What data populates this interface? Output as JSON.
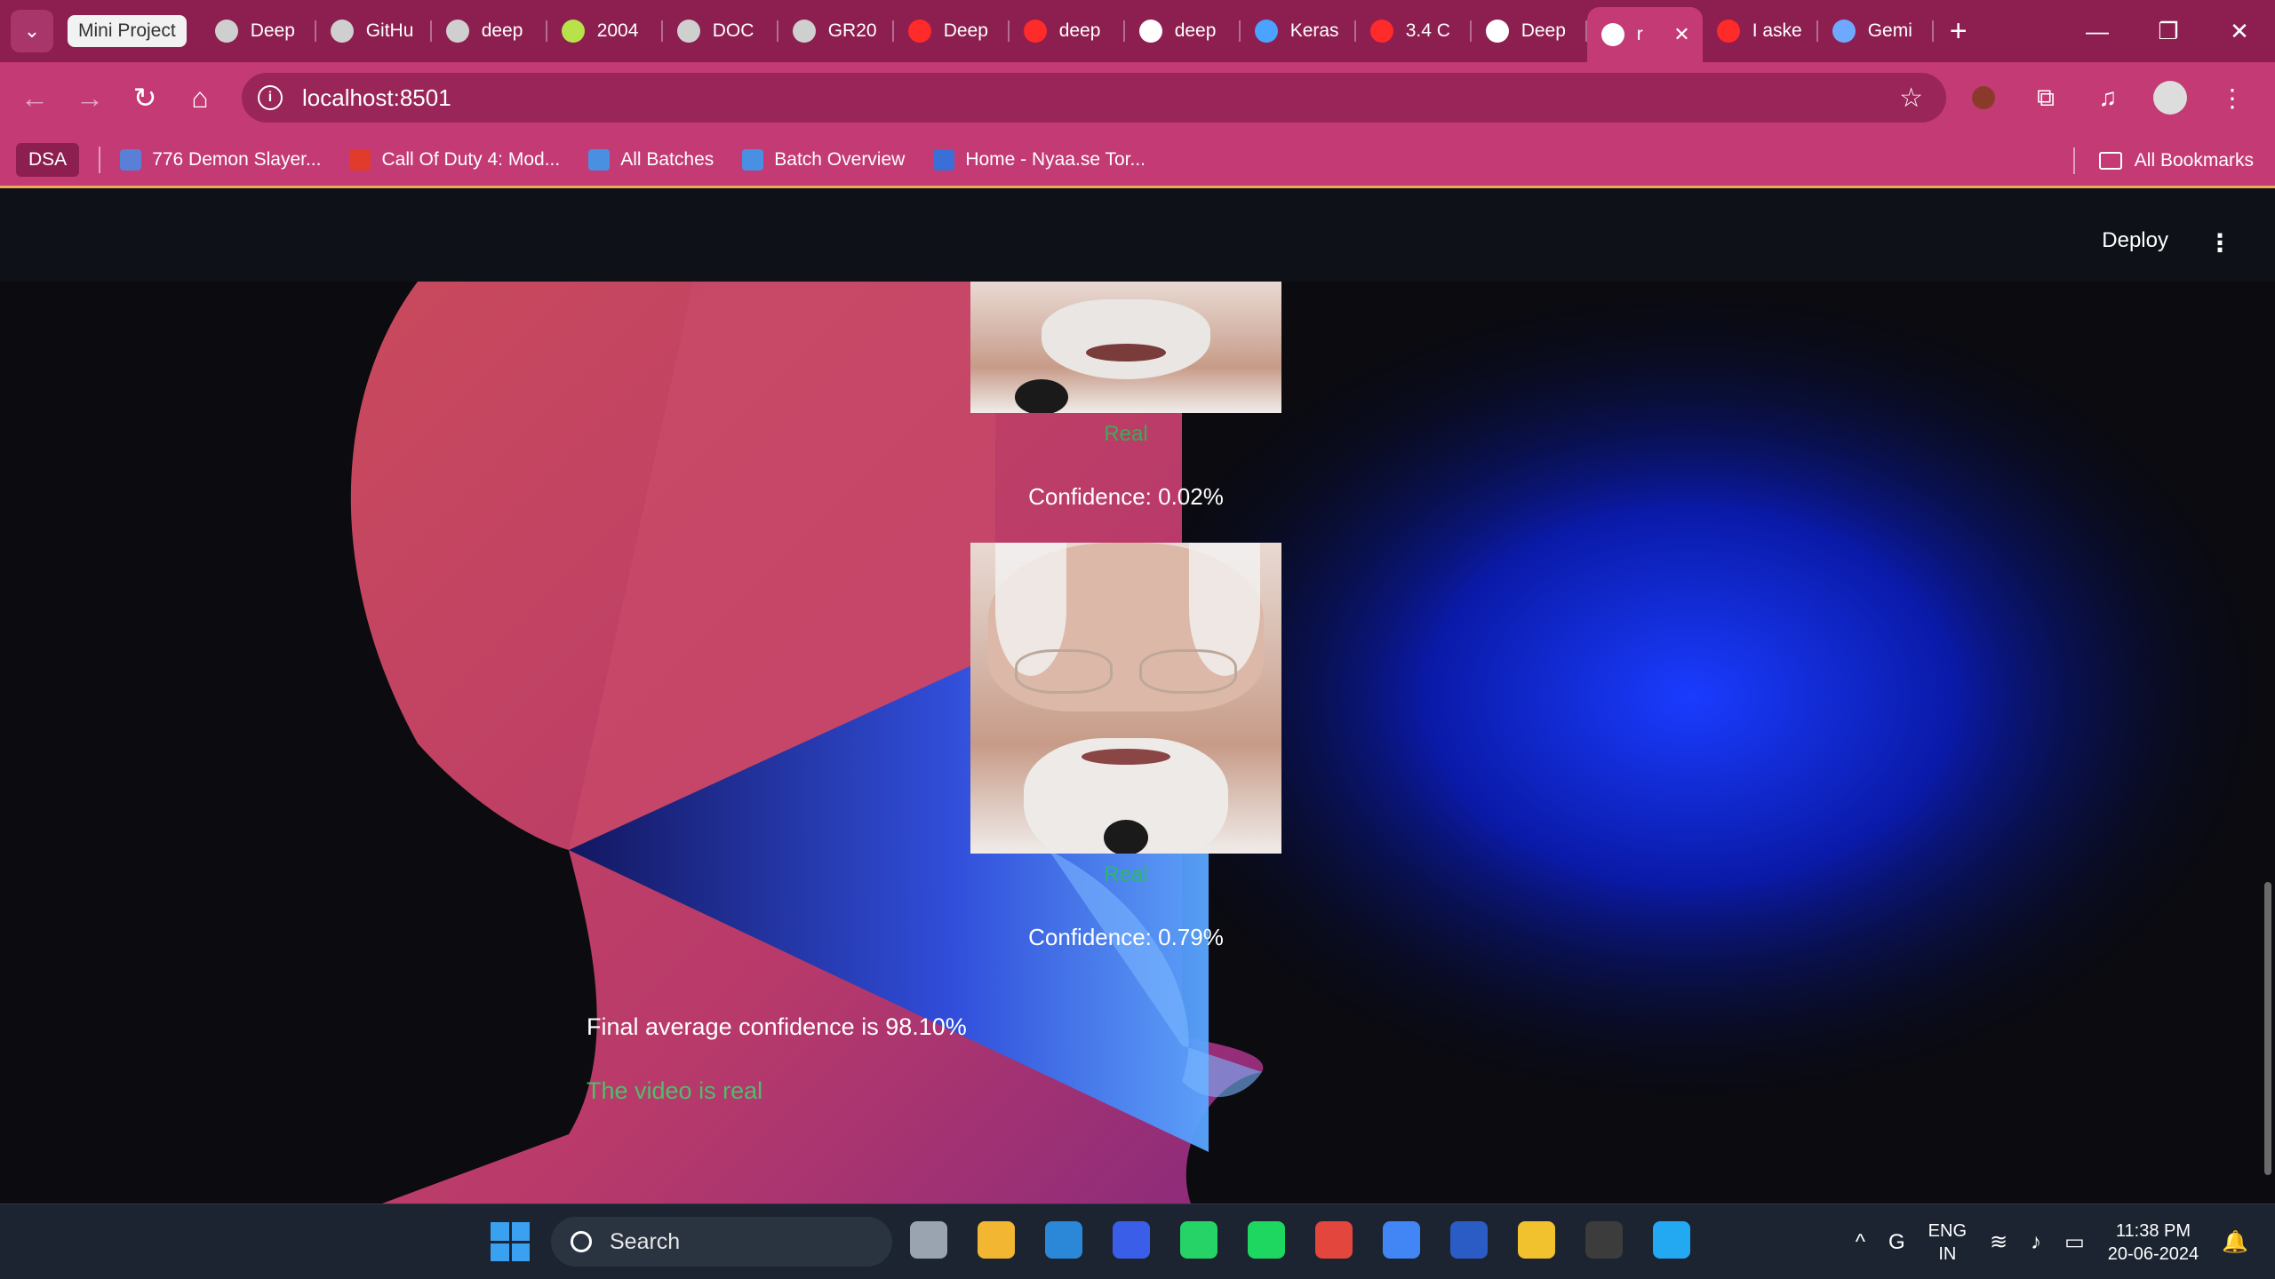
{
  "browser": {
    "tab_group": "Mini Project",
    "tabs": [
      {
        "label": "Deep",
        "icon": "globe-icon",
        "color": "#cfcfcf"
      },
      {
        "label": "GitHu",
        "icon": "github-icon",
        "color": "#cfcfcf"
      },
      {
        "label": "deep",
        "icon": "github-icon",
        "color": "#cfcfcf"
      },
      {
        "label": "2004",
        "icon": "emoji-icon",
        "color": "#b7e24a"
      },
      {
        "label": "DOC",
        "icon": "globe-icon",
        "color": "#cfcfcf"
      },
      {
        "label": "GR20",
        "icon": "globe-icon",
        "color": "#cfcfcf"
      },
      {
        "label": "Deep",
        "icon": "youtube-icon",
        "color": "#ff2a2a"
      },
      {
        "label": "deep",
        "icon": "youtube-icon",
        "color": "#ff2a2a"
      },
      {
        "label": "deep",
        "icon": "github-icon",
        "color": "#ffffff"
      },
      {
        "label": "Keras",
        "icon": "keras-icon",
        "color": "#4aa3ff"
      },
      {
        "label": "3.4 C",
        "icon": "youtube-icon",
        "color": "#ff2a2a"
      },
      {
        "label": "Deep",
        "icon": "openai-icon",
        "color": "#ffffff"
      },
      {
        "label": "r",
        "icon": "streamlit-icon",
        "color": "#ffffff",
        "active": true
      },
      {
        "label": "I aske",
        "icon": "youtube-icon",
        "color": "#ff2a2a"
      },
      {
        "label": "Gemi",
        "icon": "gemini-icon",
        "color": "#6fa8ff"
      }
    ],
    "url": "localhost:8501",
    "bookmarks": {
      "folder": "DSA",
      "items": [
        {
          "label": "776 Demon Slayer...",
          "color": "#5a7fd6"
        },
        {
          "label": "Call Of Duty 4: Mod...",
          "color": "#e03b2b"
        },
        {
          "label": "All Batches",
          "color": "#4a90e2"
        },
        {
          "label": "Batch Overview",
          "color": "#4a90e2"
        },
        {
          "label": "Home - Nyaa.se Tor...",
          "color": "#3a6fd8"
        }
      ],
      "all_bookmarks": "All Bookmarks"
    }
  },
  "app": {
    "deploy": "Deploy",
    "results": [
      {
        "label": "Real",
        "confidence": "Confidence: 0.02%"
      },
      {
        "label": "Real",
        "confidence": "Confidence: 0.79%"
      }
    ],
    "final_confidence": "Final average confidence is 98.10%",
    "verdict": "The video is real",
    "colors": {
      "real_label": "#21c354",
      "verdict": "#3dd56d"
    }
  },
  "taskbar": {
    "search_placeholder": "Search",
    "apps": [
      {
        "name": "task-view",
        "color": "#9aa4b1"
      },
      {
        "name": "file-explorer",
        "color": "#f2b632"
      },
      {
        "name": "microsoft-store",
        "color": "#2b88d8"
      },
      {
        "name": "code-editor",
        "color": "#3b5ee8"
      },
      {
        "name": "whatsapp",
        "color": "#25d366"
      },
      {
        "name": "spotify",
        "color": "#1ed760"
      },
      {
        "name": "chrome-profile",
        "color": "#e2463d"
      },
      {
        "name": "chrome",
        "color": "#4285f4"
      },
      {
        "name": "word",
        "color": "#2b5cc6"
      },
      {
        "name": "starred-app",
        "color": "#f2c12e"
      },
      {
        "name": "terminal",
        "color": "#3c3c3c"
      },
      {
        "name": "vscode",
        "color": "#23a9f2"
      }
    ],
    "lang_line1": "ENG",
    "lang_line2": "IN",
    "time": "11:38 PM",
    "date": "20-06-2024"
  }
}
